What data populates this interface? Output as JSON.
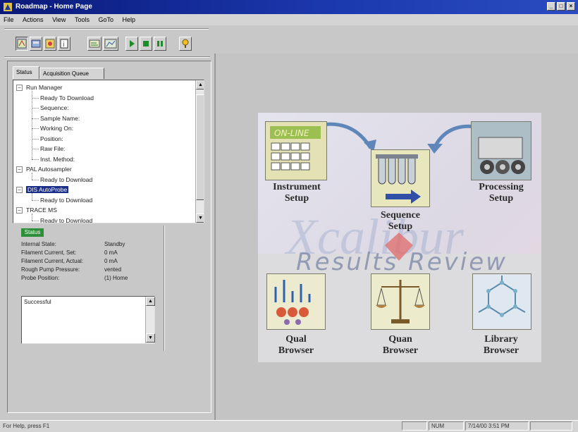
{
  "window": {
    "title": "Roadmap - Home Page",
    "controls": [
      "_",
      "□",
      "×"
    ]
  },
  "menu": [
    "File",
    "Actions",
    "View",
    "Tools",
    "GoTo",
    "Help"
  ],
  "toolbar": {
    "icons": [
      "roadmap-view-icon",
      "instrument-view-icon",
      "sequence-view-icon",
      "info-icon",
      "setup-icon",
      "chart-icon",
      "start-icon",
      "stop-icon",
      "pause-icon",
      "help-icon"
    ]
  },
  "tabs": [
    "Status",
    "Acquisition Queue"
  ],
  "tree": [
    {
      "label": "Run Manager",
      "level": 0,
      "expander": "−"
    },
    {
      "label": "Ready To Download",
      "level": 1
    },
    {
      "label": "Sequence:",
      "level": 1
    },
    {
      "label": "Sample Name:",
      "level": 1
    },
    {
      "label": "Working On:",
      "level": 1
    },
    {
      "label": "Position:",
      "level": 1
    },
    {
      "label": "Raw File:",
      "level": 1
    },
    {
      "label": "Inst. Method:",
      "level": 1
    },
    {
      "label": "PAL Autosampler",
      "level": 0,
      "expander": "−"
    },
    {
      "label": "Ready to Download",
      "level": 1
    },
    {
      "label": "DIS AutoProbe",
      "level": 0,
      "expander": "−",
      "selected": true
    },
    {
      "label": "Ready to Download",
      "level": 1
    },
    {
      "label": "TRACE MS",
      "level": 0,
      "expander": "−"
    },
    {
      "label": "Ready to Download",
      "level": 1
    }
  ],
  "status": {
    "badge": "Status",
    "rows": [
      {
        "label": "Internal State:",
        "value": "Standby"
      },
      {
        "label": "Filament Current, Set:",
        "value": "0 mA"
      },
      {
        "label": "Filament Current, Actual:",
        "value": "0 mA"
      },
      {
        "label": "Rough Pump Pressure:",
        "value": "vented"
      },
      {
        "label": "Probe Position:",
        "value": "(1) Home"
      }
    ],
    "message": "Successful"
  },
  "roadmap": {
    "watermark": "Xcalibur",
    "results_review": "Results Review",
    "instrument_logo": "ON-LINE",
    "items": [
      {
        "id": "instrument",
        "label_lines": [
          "Instrument",
          "Setup"
        ]
      },
      {
        "id": "sequence",
        "label_lines": [
          "Sequence",
          "Setup"
        ]
      },
      {
        "id": "processing",
        "label_lines": [
          "Processing",
          "Setup"
        ]
      },
      {
        "id": "qual",
        "label_lines": [
          "Qual",
          "Browser"
        ]
      },
      {
        "id": "quan",
        "label_lines": [
          "Quan",
          "Browser"
        ]
      },
      {
        "id": "library",
        "label_lines": [
          "Library",
          "Browser"
        ]
      }
    ]
  },
  "statusbar": {
    "help": "For Help, press F1",
    "num": "NUM",
    "datetime": "7/14/00  3:51 PM"
  },
  "colors": {
    "titlebar": "#0a1a7a",
    "selection": "#1a2e8a",
    "status_badge": "#2e8f3a",
    "arrow": "#5f86b8"
  }
}
